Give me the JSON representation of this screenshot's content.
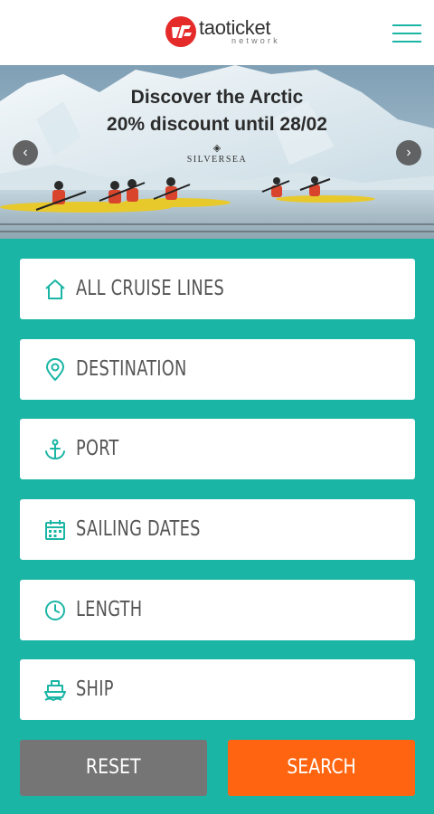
{
  "header": {
    "logo_main": "taoticket",
    "logo_sub": "network",
    "menu_icon": "hamburger-menu-icon"
  },
  "banner": {
    "line1": "Discover the Arctic",
    "line2": "20% discount until 28/02",
    "brand": "SILVERSEA",
    "prev_icon": "chevron-left-icon",
    "next_icon": "chevron-right-icon"
  },
  "form": {
    "fields": [
      {
        "label": "ALL CRUISE LINES",
        "icon": "home-icon"
      },
      {
        "label": "DESTINATION",
        "icon": "map-pin-icon"
      },
      {
        "label": "PORT",
        "icon": "anchor-icon"
      },
      {
        "label": "SAILING DATES",
        "icon": "calendar-icon"
      },
      {
        "label": "LENGTH",
        "icon": "clock-icon"
      },
      {
        "label": "SHIP",
        "icon": "ship-icon"
      }
    ],
    "reset_label": "RESET",
    "search_label": "SEARCH"
  },
  "colors": {
    "accent": "#1bb5a5",
    "search_button": "#ff6510",
    "reset_button": "#757575",
    "logo_red": "#e52a2a"
  }
}
